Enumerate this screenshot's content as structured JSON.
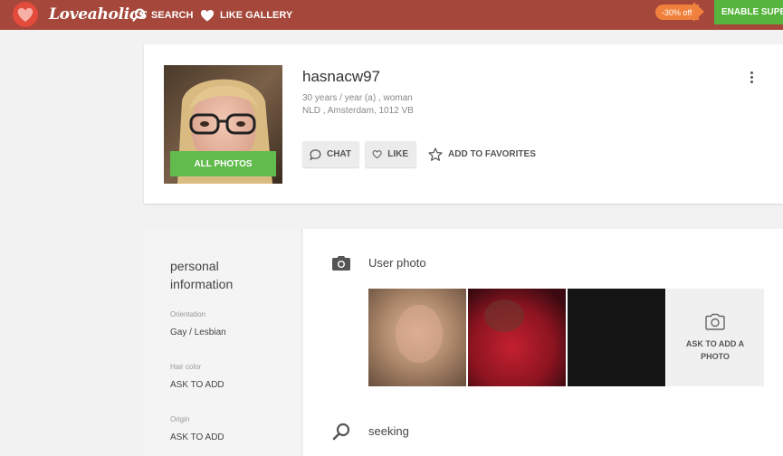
{
  "header": {
    "logo_text": "Loveaholics",
    "nav_search": "SEARCH",
    "nav_like_gallery": "LIKE GALLERY",
    "discount": "-30% off",
    "enable_button": "ENABLE SUPER"
  },
  "profile": {
    "username": "hasnacw97",
    "age_gender": "30 years / year (a) , woman",
    "location": "NLD , Amsterdam, 1012 VB",
    "all_photos": "ALL PHOTOS",
    "chat": "CHAT",
    "like": "LIKE",
    "add_favorites": "ADD TO FAVORITES"
  },
  "info": {
    "title": "personal information",
    "fields": [
      {
        "label": "Orientation",
        "value": "Gay / Lesbian"
      },
      {
        "label": "Hair color",
        "value": "ASK TO ADD"
      },
      {
        "label": "Origin",
        "value": "ASK TO ADD"
      }
    ]
  },
  "main": {
    "user_photo_title": "User photo",
    "add_photo_label": "ASK TO ADD A PHOTO",
    "seeking_title": "seeking"
  },
  "colors": {
    "header_bg": "#a5473a",
    "accent_green": "#62bb4d",
    "discount_orange": "#f0813c"
  },
  "icons": [
    "heart-logo-icon",
    "search-icon",
    "heart-icon",
    "chat-icon",
    "like-heart-icon",
    "star-icon",
    "more-vert-icon",
    "camera-icon",
    "search-icon"
  ]
}
